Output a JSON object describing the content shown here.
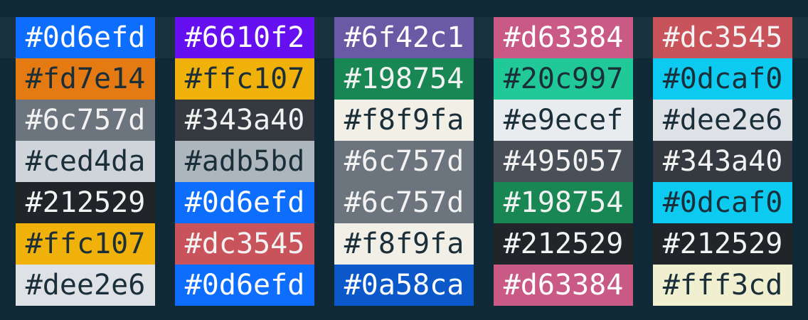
{
  "columns": [
    {
      "swatches": [
        {
          "label": "#0d6efd",
          "bg": "#0d6efd",
          "fg": "#ffffff"
        },
        {
          "label": "#fd7e14",
          "bg": "#e67a12",
          "fg": "#1b2f3a"
        },
        {
          "label": "#6c757d",
          "bg": "#6c757d",
          "fg": "#f2f2f2"
        },
        {
          "label": "#ced4da",
          "bg": "#ced4da",
          "fg": "#1b2f3a"
        },
        {
          "label": "#212529",
          "bg": "#212529",
          "fg": "#f3f3f3"
        },
        {
          "label": "#ffc107",
          "bg": "#f0b20a",
          "fg": "#1b2f3a"
        },
        {
          "label": "#dee2e6",
          "bg": "#dee2e6",
          "fg": "#1b2f3a"
        }
      ]
    },
    {
      "swatches": [
        {
          "label": "#6610f2",
          "bg": "#6610f2",
          "fg": "#ffffff"
        },
        {
          "label": "#ffc107",
          "bg": "#f0b20a",
          "fg": "#1b2f3a"
        },
        {
          "label": "#343a40",
          "bg": "#343a40",
          "fg": "#f2f2f2"
        },
        {
          "label": "#adb5bd",
          "bg": "#adb5bd",
          "fg": "#1b2f3a"
        },
        {
          "label": "#0d6efd",
          "bg": "#0d6efd",
          "fg": "#ffffff"
        },
        {
          "label": "#dc3545",
          "bg": "#c9535b",
          "fg": "#f2f2f2"
        },
        {
          "label": "#0d6efd",
          "bg": "#0d6efd",
          "fg": "#ffffff"
        }
      ]
    },
    {
      "swatches": [
        {
          "label": "#6f42c1",
          "bg": "#6a5aa6",
          "fg": "#ffffff"
        },
        {
          "label": "#198754",
          "bg": "#198754",
          "fg": "#f2f2f2"
        },
        {
          "label": "#f8f9fa",
          "bg": "#f1efe6",
          "fg": "#1b2f3a"
        },
        {
          "label": "#6c757d",
          "bg": "#6c757d",
          "fg": "#f2f2f2"
        },
        {
          "label": "#6c757d",
          "bg": "#6c757d",
          "fg": "#f2f2f2"
        },
        {
          "label": "#f8f9fa",
          "bg": "#f1efe6",
          "fg": "#1b2f3a"
        },
        {
          "label": "#0a58ca",
          "bg": "#0a58ca",
          "fg": "#ffffff"
        }
      ]
    },
    {
      "swatches": [
        {
          "label": "#d63384",
          "bg": "#c95a85",
          "fg": "#ffffff"
        },
        {
          "label": "#20c997",
          "bg": "#20c997",
          "fg": "#1b2f3a"
        },
        {
          "label": "#e9ecef",
          "bg": "#e9ecef",
          "fg": "#1b2f3a"
        },
        {
          "label": "#495057",
          "bg": "#495057",
          "fg": "#f2f2f2"
        },
        {
          "label": "#198754",
          "bg": "#198754",
          "fg": "#f2f2f2"
        },
        {
          "label": "#212529",
          "bg": "#212529",
          "fg": "#f3f3f3"
        },
        {
          "label": "#d63384",
          "bg": "#c95a85",
          "fg": "#ffffff"
        }
      ]
    },
    {
      "swatches": [
        {
          "label": "#dc3545",
          "bg": "#c9535b",
          "fg": "#f2f2f2"
        },
        {
          "label": "#0dcaf0",
          "bg": "#0dcaf0",
          "fg": "#1b2f3a"
        },
        {
          "label": "#dee2e6",
          "bg": "#dee2e6",
          "fg": "#1b2f3a"
        },
        {
          "label": "#343a40",
          "bg": "#343a40",
          "fg": "#f2f2f2"
        },
        {
          "label": "#0dcaf0",
          "bg": "#0dcaf0",
          "fg": "#1b2f3a"
        },
        {
          "label": "#212529",
          "bg": "#212529",
          "fg": "#f3f3f3"
        },
        {
          "label": "#fff3cd",
          "bg": "#f0f0d0",
          "fg": "#1b2f3a"
        }
      ]
    }
  ]
}
